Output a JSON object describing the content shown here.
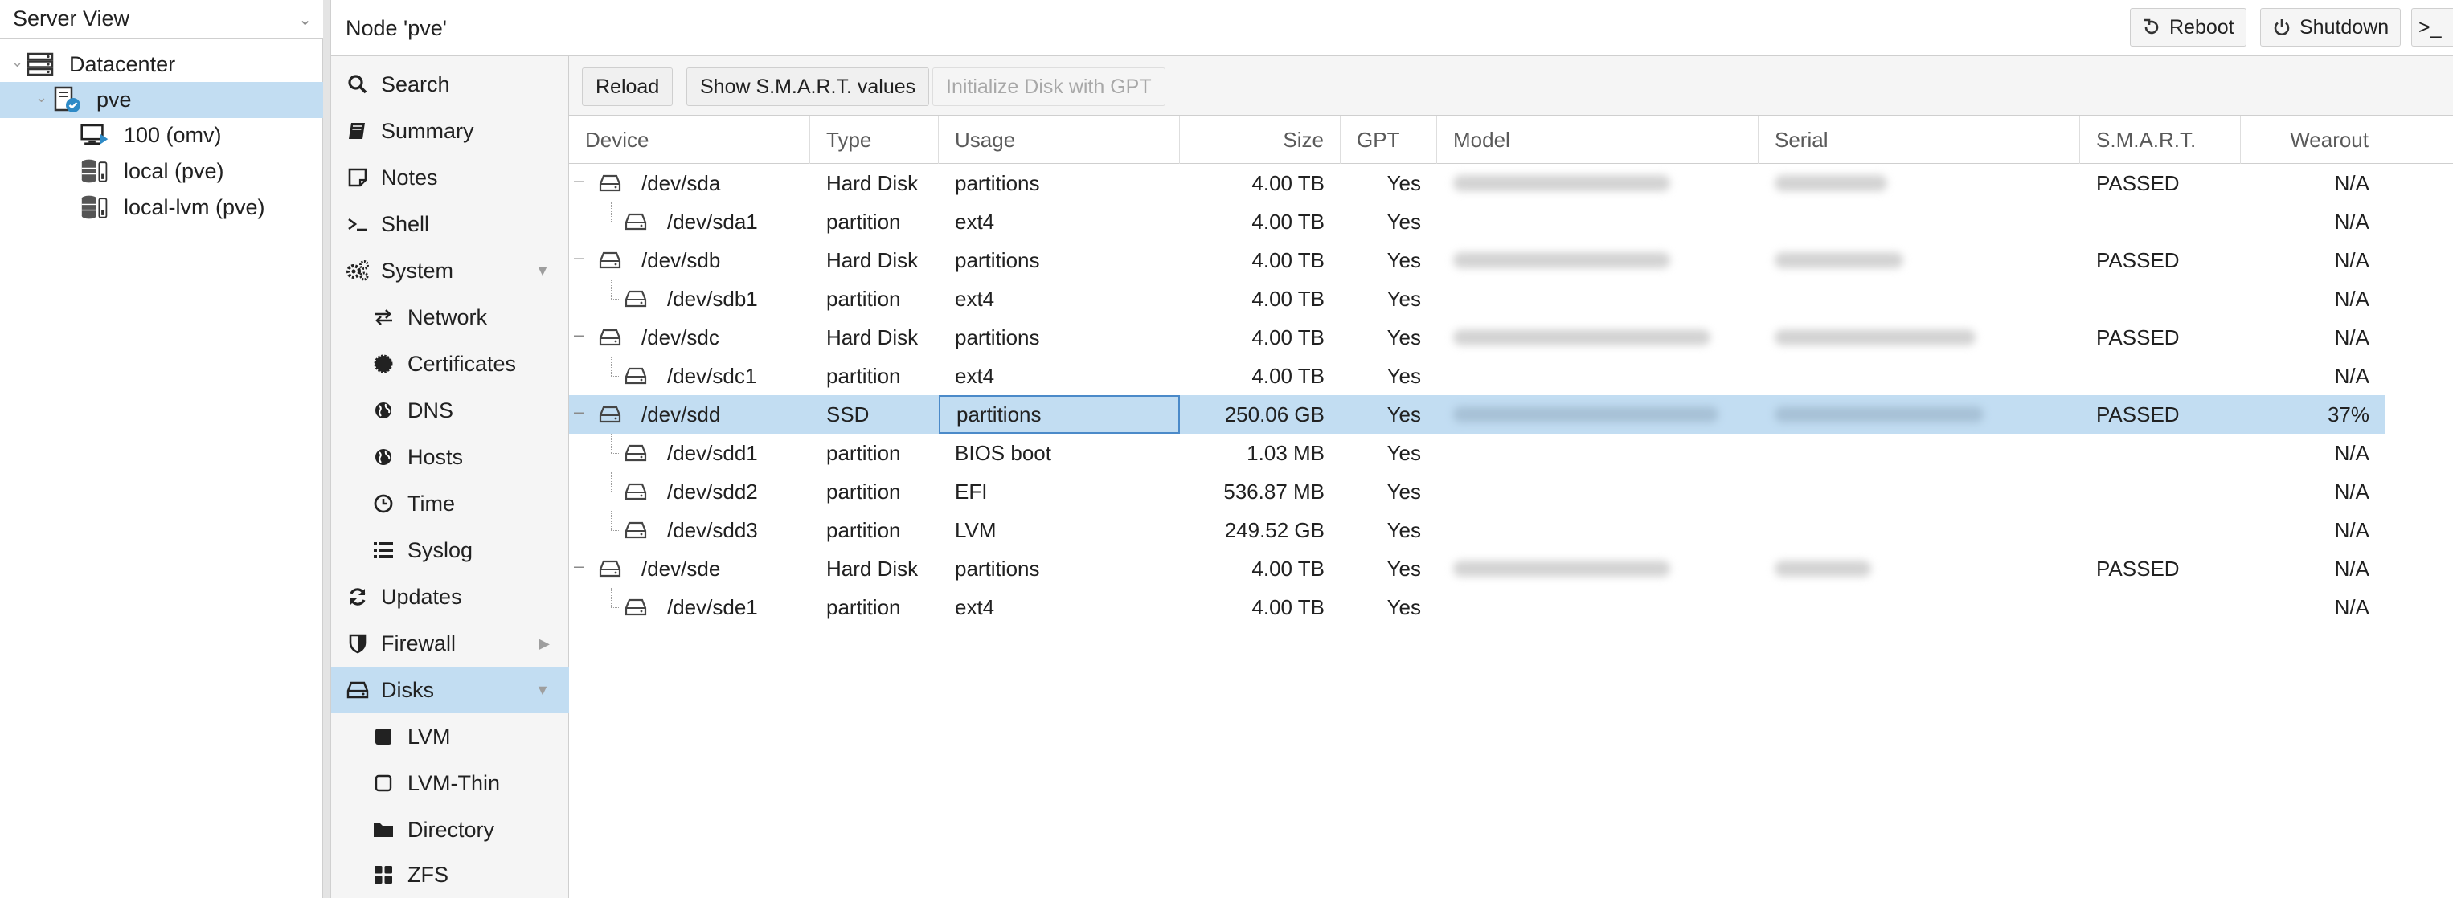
{
  "tree": {
    "view_label": "Server View",
    "items": [
      {
        "label": "Datacenter"
      },
      {
        "label": "pve"
      },
      {
        "label": "100 (omv)"
      },
      {
        "label": "local (pve)"
      },
      {
        "label": "local-lvm (pve)"
      }
    ]
  },
  "header": {
    "title": "Node 'pve'",
    "reboot_label": "Reboot",
    "shutdown_label": "Shutdown",
    "shell_label": ">_"
  },
  "nav": {
    "items": [
      {
        "label": "Search",
        "icon": "search-icon"
      },
      {
        "label": "Summary",
        "icon": "book-icon"
      },
      {
        "label": "Notes",
        "icon": "sticky-note-icon"
      },
      {
        "label": "Shell",
        "icon": "terminal-icon"
      },
      {
        "label": "System",
        "icon": "cogs-icon"
      },
      {
        "label": "Network",
        "icon": "exchange-icon"
      },
      {
        "label": "Certificates",
        "icon": "certificate-icon"
      },
      {
        "label": "DNS",
        "icon": "globe-icon"
      },
      {
        "label": "Hosts",
        "icon": "globe-icon"
      },
      {
        "label": "Time",
        "icon": "clock-icon"
      },
      {
        "label": "Syslog",
        "icon": "list-icon"
      },
      {
        "label": "Updates",
        "icon": "refresh-icon"
      },
      {
        "label": "Firewall",
        "icon": "shield-icon"
      },
      {
        "label": "Disks",
        "icon": "hdd-icon"
      },
      {
        "label": "LVM",
        "icon": "square-icon"
      },
      {
        "label": "LVM-Thin",
        "icon": "square-outline-icon"
      },
      {
        "label": "Directory",
        "icon": "folder-icon"
      },
      {
        "label": "ZFS",
        "icon": "th-large-icon"
      }
    ]
  },
  "toolbar": {
    "reload_label": "Reload",
    "smart_label": "Show S.M.A.R.T. values",
    "init_gpt_label": "Initialize Disk with GPT"
  },
  "grid": {
    "columns": [
      "Device",
      "Type",
      "Usage",
      "Size",
      "GPT",
      "Model",
      "Serial",
      "S.M.A.R.T.",
      "Wearout"
    ],
    "rows": [
      {
        "device": "/dev/sda",
        "type": "Hard Disk",
        "usage": "partitions",
        "size": "4.00 TB",
        "gpt": "Yes",
        "smart": "PASSED",
        "wearout": "N/A"
      },
      {
        "device": "/dev/sda1",
        "type": "partition",
        "usage": "ext4",
        "size": "4.00 TB",
        "gpt": "Yes",
        "smart": "",
        "wearout": "N/A"
      },
      {
        "device": "/dev/sdb",
        "type": "Hard Disk",
        "usage": "partitions",
        "size": "4.00 TB",
        "gpt": "Yes",
        "smart": "PASSED",
        "wearout": "N/A"
      },
      {
        "device": "/dev/sdb1",
        "type": "partition",
        "usage": "ext4",
        "size": "4.00 TB",
        "gpt": "Yes",
        "smart": "",
        "wearout": "N/A"
      },
      {
        "device": "/dev/sdc",
        "type": "Hard Disk",
        "usage": "partitions",
        "size": "4.00 TB",
        "gpt": "Yes",
        "smart": "PASSED",
        "wearout": "N/A"
      },
      {
        "device": "/dev/sdc1",
        "type": "partition",
        "usage": "ext4",
        "size": "4.00 TB",
        "gpt": "Yes",
        "smart": "",
        "wearout": "N/A"
      },
      {
        "device": "/dev/sdd",
        "type": "SSD",
        "usage": "partitions",
        "size": "250.06 GB",
        "gpt": "Yes",
        "smart": "PASSED",
        "wearout": "37%"
      },
      {
        "device": "/dev/sdd1",
        "type": "partition",
        "usage": "BIOS boot",
        "size": "1.03 MB",
        "gpt": "Yes",
        "smart": "",
        "wearout": "N/A"
      },
      {
        "device": "/dev/sdd2",
        "type": "partition",
        "usage": "EFI",
        "size": "536.87 MB",
        "gpt": "Yes",
        "smart": "",
        "wearout": "N/A"
      },
      {
        "device": "/dev/sdd3",
        "type": "partition",
        "usage": "LVM",
        "size": "249.52 GB",
        "gpt": "Yes",
        "smart": "",
        "wearout": "N/A"
      },
      {
        "device": "/dev/sde",
        "type": "Hard Disk",
        "usage": "partitions",
        "size": "4.00 TB",
        "gpt": "Yes",
        "smart": "PASSED",
        "wearout": "N/A"
      },
      {
        "device": "/dev/sde1",
        "type": "partition",
        "usage": "ext4",
        "size": "4.00 TB",
        "gpt": "Yes",
        "smart": "",
        "wearout": "N/A"
      }
    ]
  },
  "colors": {
    "selection": "#c2ddf2",
    "focus_border": "#4b8ac9",
    "border": "#cfcfcf"
  }
}
